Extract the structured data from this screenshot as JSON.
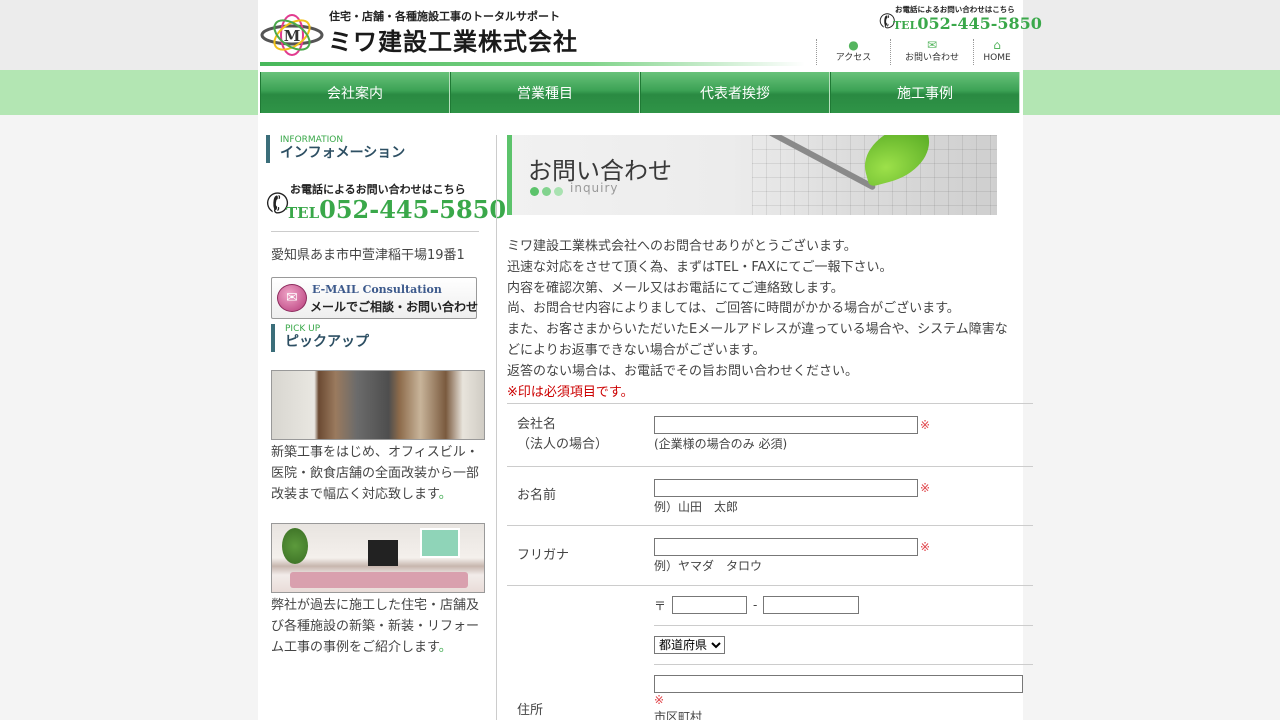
{
  "header": {
    "tagline": "住宅・店舗・各種施設工事のトータルサポート",
    "company": "ミワ建設工業株式会社",
    "tel_caption": "お電話によるお問い合わせはこちら",
    "tel_prefix": "TEL",
    "tel_number": "052-445-5850",
    "links": [
      {
        "label": "アクセス",
        "icon": "location-pin-icon"
      },
      {
        "label": "お問い合わせ",
        "icon": "envelope-icon"
      },
      {
        "label": "HOME",
        "icon": "home-icon"
      }
    ]
  },
  "nav": {
    "items": [
      {
        "label": "会社案内"
      },
      {
        "label": "営業種目"
      },
      {
        "label": "代表者挨拶"
      },
      {
        "label": "施工事例"
      }
    ]
  },
  "sidebar": {
    "info_en": "INFORMATION",
    "info_jp": "インフォメーション",
    "tel_caption": "お電話によるお問い合わせはこちら",
    "tel_prefix": "TEL",
    "tel_number": "052-445-5850",
    "address": "愛知県あま市中萱津稲干場19番1",
    "mail_en": "E-MAIL Consultation",
    "mail_jp": "メールでご相談・お問い合わせ",
    "pickup_en": "PICK UP",
    "pickup_jp": "ピックアップ",
    "pickups": [
      {
        "text": "新築工事をはじめ、オフィスビル・医院・飲食店舗の全面改装から一部改装まで幅広く対応致します",
        "dot": "。"
      },
      {
        "text": "弊社が過去に施工した住宅・店舗及び各種施設の新築・新装・リフォーム工事の事例をご紹介します",
        "dot": "。"
      }
    ]
  },
  "main": {
    "banner_title": "お問い合わせ",
    "banner_sub": "inquiry",
    "intro_lines": [
      "ミワ建設工業株式会社へのお問合せありがとうございます。",
      "迅速な対応をさせて頂く為、まずはTEL・FAXにてご一報下さい。",
      "内容を確認次第、メール又はお電話にてご連絡致します。",
      "尚、お問合せ内容によりましては、ご回答に時間がかかる場合がございます。",
      "また、お客さまからいただいたEメールアドレスが違っている場合や、システム障害などによりお返事できない場合がございます。",
      "返答のない場合は、お電話でその旨お問い合わせください。"
    ],
    "required_note": "※印は必須項目です。"
  },
  "form": {
    "required_mark": "※",
    "company_label": "会社名",
    "company_label2": "（法人の場合）",
    "company_hint": "(企業様の場合のみ 必須)",
    "company_value": "",
    "name_label": "お名前",
    "name_hint": "例）山田　太郎",
    "name_value": "",
    "kana_label": "フリガナ",
    "kana_hint": "例）ヤマダ　タロウ",
    "kana_value": "",
    "zip_prefix": "〒",
    "zip_sep": "-",
    "zip1_value": "",
    "zip2_value": "",
    "address_label": "住所",
    "pref_selected": "都道府県",
    "address_value": "",
    "city_hint": "市区町村"
  },
  "colors": {
    "accent_green": "#3aa84a",
    "nav_band": "#b3e6b3",
    "required_red": "#cc0000"
  }
}
